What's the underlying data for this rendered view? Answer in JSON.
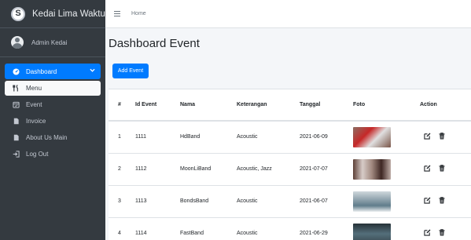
{
  "brand": {
    "logo_glyph": "S",
    "name": "Kedai Lima Waktu"
  },
  "user": {
    "name": "Admin Kedai"
  },
  "sidebar": {
    "items": [
      {
        "label": "Dashboard",
        "icon": "dashboard-icon"
      },
      {
        "label": "Menu",
        "icon": "utensils-icon"
      },
      {
        "label": "Event",
        "icon": "calendar-icon"
      },
      {
        "label": "Invoice",
        "icon": "file-icon"
      },
      {
        "label": "About Us Main",
        "icon": "file-icon"
      },
      {
        "label": "Log Out",
        "icon": "sign-out-icon"
      }
    ]
  },
  "topbar": {
    "home_label": "Home"
  },
  "page": {
    "title": "Dashboard Event",
    "add_button_label": "Add Event"
  },
  "table": {
    "headers": [
      "#",
      "Id Event",
      "Nama",
      "Keterangan",
      "Tanggal",
      "Foto",
      "Action"
    ],
    "rows": [
      {
        "no": "1",
        "id_event": "1111",
        "nama": "HdBand",
        "keterangan": "Acoustic",
        "tanggal": "2021-06-09"
      },
      {
        "no": "2",
        "id_event": "1112",
        "nama": "MoonLiBand",
        "keterangan": "Acoustic, Jazz",
        "tanggal": "2021-07-07"
      },
      {
        "no": "3",
        "id_event": "1113",
        "nama": "BondsBand",
        "keterangan": "Acoustic",
        "tanggal": "2021-06-07"
      },
      {
        "no": "4",
        "id_event": "1114",
        "nama": "FastBand",
        "keterangan": "Acoustic",
        "tanggal": "2021-06-29"
      }
    ]
  },
  "colors": {
    "sidebar": "#343a40",
    "primary": "#007bff",
    "content_bg": "#f4f6f9"
  }
}
